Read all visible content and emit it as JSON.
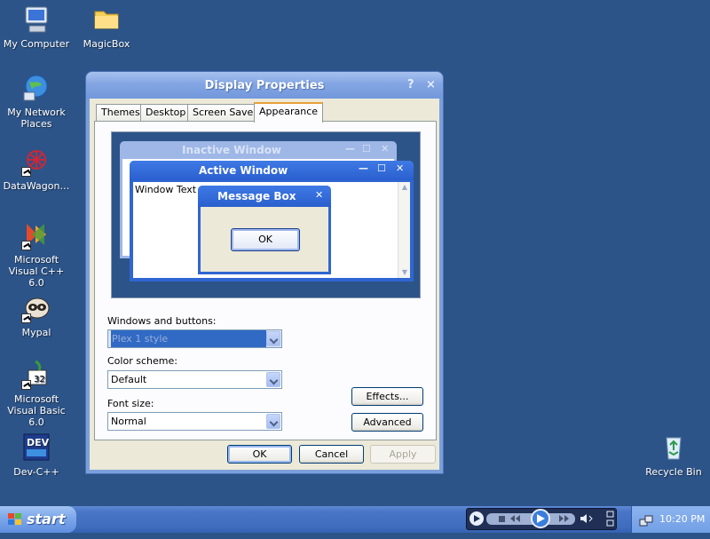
{
  "desktop": {
    "icons": [
      {
        "label": "My Computer",
        "icon": "computer-icon"
      },
      {
        "label": "MagicBox",
        "icon": "folder-icon"
      },
      {
        "label": "My Network Places",
        "icon": "network-icon"
      },
      {
        "label": "DataWagon…",
        "icon": "datawagon-icon"
      },
      {
        "label": "Microsoft Visual C++ 6.0",
        "icon": "visual-cpp-icon"
      },
      {
        "label": "Mypal",
        "icon": "mypal-icon"
      },
      {
        "label": "Microsoft Visual Basic 6.0",
        "icon": "visual-basic-icon"
      },
      {
        "label": "Dev-C++",
        "icon": "devcpp-icon"
      },
      {
        "label": "Recycle Bin",
        "icon": "recycle-bin-icon"
      }
    ],
    "background": "#2c5488"
  },
  "window": {
    "title": "Display Properties",
    "help": "?",
    "close": "×",
    "tabs": [
      "Themes",
      "Desktop",
      "Screen Saver",
      "Appearance"
    ],
    "active_tab": "Appearance",
    "preview": {
      "inactive_title": "Inactive Window",
      "active_title": "Active Window",
      "window_text": "Window Text",
      "message_title": "Message Box",
      "message_ok": "OK"
    },
    "windows_buttons_label": "Windows and buttons:",
    "windows_buttons_value": "Plex 1 style",
    "color_scheme_label": "Color scheme:",
    "color_scheme_value": "Default",
    "font_size_label": "Font size:",
    "font_size_value": "Normal",
    "effects_button": "Effects...",
    "advanced_button": "Advanced",
    "ok_button": "OK",
    "cancel_button": "Cancel",
    "apply_button": "Apply"
  },
  "taskbar": {
    "start_label": "start",
    "clock": "10:20 PM"
  }
}
